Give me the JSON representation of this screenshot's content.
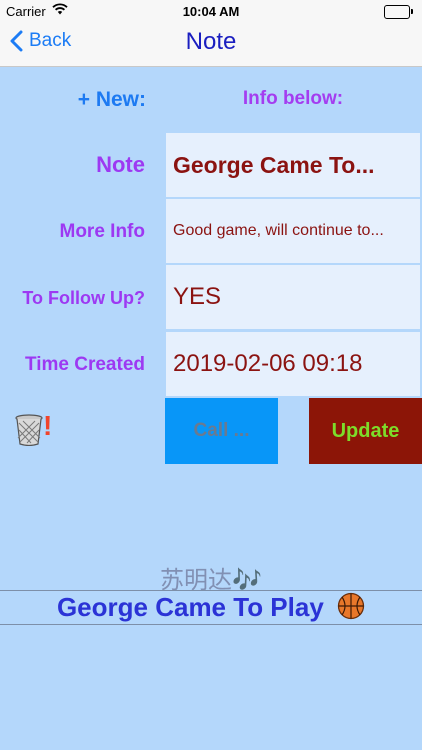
{
  "status_bar": {
    "carrier": "Carrier",
    "time": "10:04 AM",
    "wifi_icon": "wifi-icon",
    "battery_level": 1.0,
    "battery_color": "#3bc34a"
  },
  "nav": {
    "back_label": "Back",
    "title": "Note",
    "accent": "#1c7cf5"
  },
  "form": {
    "new_label": "+ New:",
    "info_label": "Info below:",
    "rows": [
      {
        "label": "Note",
        "value": "George Came To..."
      },
      {
        "label": "More Info",
        "value": "Good game, will continue to..."
      },
      {
        "label": "To Follow Up?",
        "value": "YES"
      },
      {
        "label": "Time Created",
        "value": "2019-02-06 09:18"
      }
    ]
  },
  "actions": {
    "trash_icon": "trash-can-icon",
    "alert_glyph": "!",
    "call_label": "Call ...",
    "call_color": "#0896f8",
    "update_label": "Update",
    "update_color": "#8c1507"
  },
  "footer": {
    "author": "苏明达🎶",
    "title": "George Came To Play",
    "title_icon": "basketball-icon"
  }
}
